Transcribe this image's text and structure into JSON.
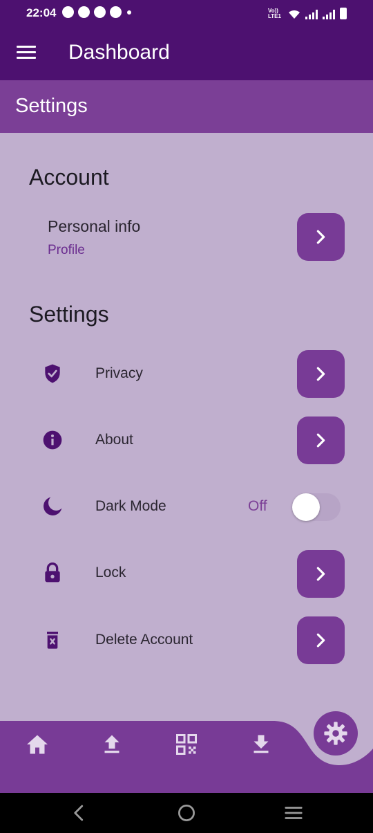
{
  "status_bar": {
    "time": "22:04",
    "network_label": "Vo)) LTE1"
  },
  "app_bar": {
    "title": "Dashboard"
  },
  "sub_header": {
    "title": "Settings"
  },
  "account": {
    "title": "Account",
    "personal_info": {
      "label": "Personal info",
      "sublabel": "Profile"
    }
  },
  "settings": {
    "title": "Settings",
    "items": [
      {
        "label": "Privacy",
        "icon": "shield-check-icon"
      },
      {
        "label": "About",
        "icon": "info-icon"
      },
      {
        "label": "Dark Mode",
        "icon": "moon-icon",
        "state": "Off"
      },
      {
        "label": "Lock",
        "icon": "lock-icon"
      },
      {
        "label": "Delete Account",
        "icon": "delete-icon"
      }
    ]
  },
  "bottom_nav": {
    "items": [
      {
        "icon": "home-icon"
      },
      {
        "icon": "upload-icon"
      },
      {
        "icon": "qr-code-icon"
      },
      {
        "icon": "download-icon"
      }
    ],
    "fab_icon": "gear-icon"
  },
  "colors": {
    "primary_dark": "#4d1170",
    "primary": "#783b96",
    "background": "#c0afce",
    "accent_text": "#6a2c8f"
  }
}
